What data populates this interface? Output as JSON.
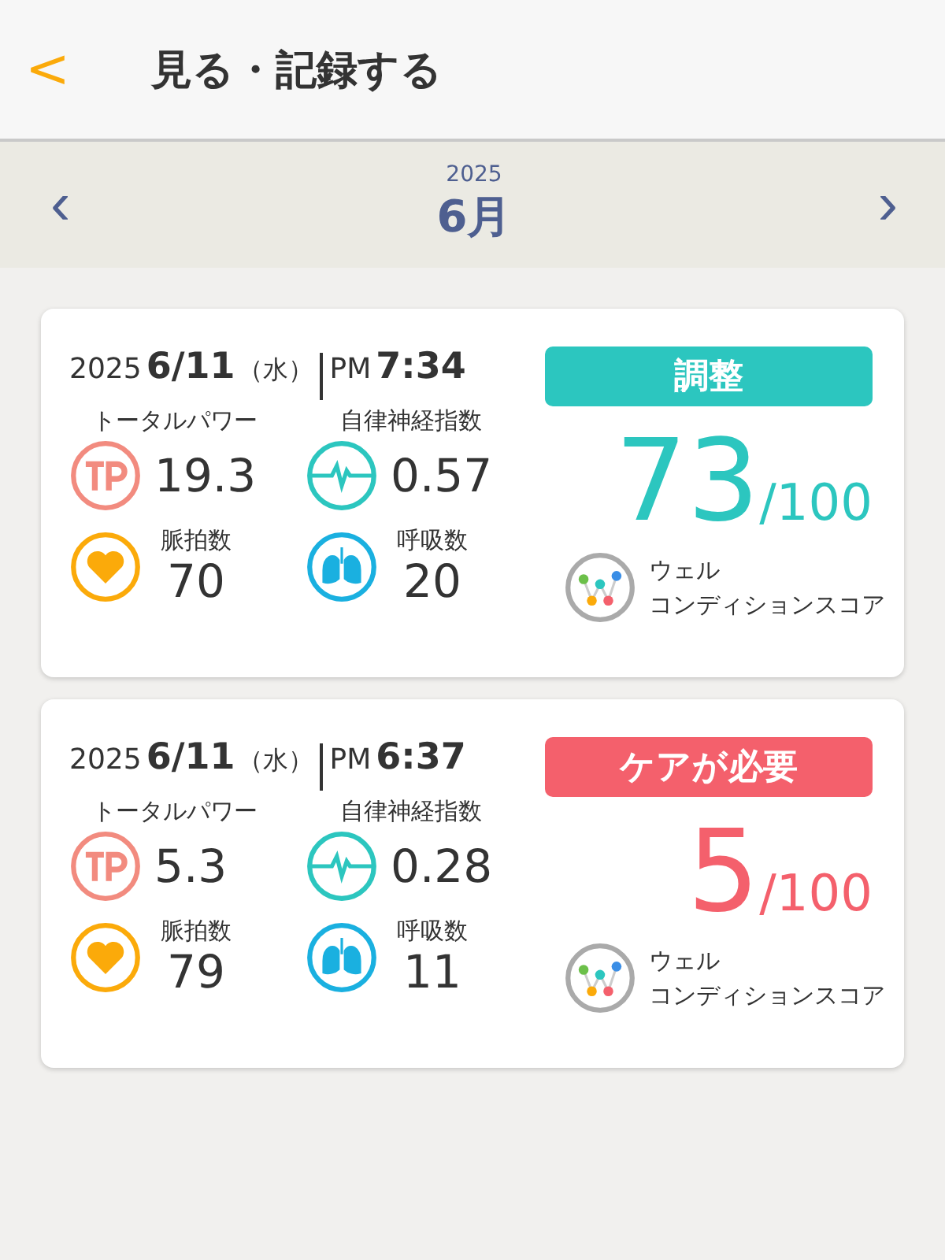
{
  "header": {
    "back": "<",
    "title": "見る・記録する"
  },
  "month_bar": {
    "prev": "‹",
    "year": "2025",
    "month": "6月",
    "next": "›"
  },
  "records": [
    {
      "year": "2025",
      "date": "6/11",
      "weekday": "（水）",
      "ampm": "PM",
      "time": "7:34",
      "status": {
        "label": "調整",
        "color": "#2cc6bf"
      },
      "total_power_label": "トータルパワー",
      "total_power": "19.3",
      "autonomic_label": "自律神経指数",
      "autonomic": "0.57",
      "pulse_label": "脈拍数",
      "pulse": "70",
      "breath_label": "呼吸数",
      "breath": "20",
      "wellness_label_1": "ウェル",
      "wellness_label_2": "コンディションスコア",
      "score": "73",
      "score_max": "/100"
    },
    {
      "year": "2025",
      "date": "6/11",
      "weekday": "（水）",
      "ampm": "PM",
      "time": "6:37",
      "status": {
        "label": "ケアが必要",
        "color": "#f4606c"
      },
      "total_power_label": "トータルパワー",
      "total_power": "5.3",
      "autonomic_label": "自律神経指数",
      "autonomic": "0.28",
      "pulse_label": "脈拍数",
      "pulse": "79",
      "breath_label": "呼吸数",
      "breath": "11",
      "wellness_label_1": "ウェル",
      "wellness_label_2": "コンディションスコア",
      "score": "5",
      "score_max": "/100"
    }
  ]
}
